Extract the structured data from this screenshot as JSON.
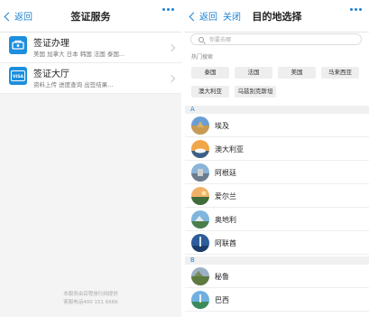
{
  "left": {
    "nav": {
      "back_label": "返回",
      "title": "签证服务"
    },
    "services": [
      {
        "title": "签证办理",
        "subtitle": "美国 加拿大 日本 韩国 法国 泰国..."
      },
      {
        "title": "签证大厅",
        "subtitle": "资料上传 进度查询 出签结果..."
      }
    ],
    "visa_badge": "VISA",
    "footer": {
      "line1": "本服务由百程旅行网提供",
      "line2": "客服电话400 151 6666"
    }
  },
  "right": {
    "nav": {
      "back_label": "返回",
      "close_label": "关闭",
      "title": "目的地选择"
    },
    "search_placeholder": "你要去哪",
    "hot_title": "热门搜索",
    "hot_items": [
      "泰国",
      "法国",
      "美国",
      "马来西亚",
      "澳大利亚",
      "乌兹别克斯坦"
    ],
    "sections": [
      {
        "letter": "A",
        "items": [
          "埃及",
          "澳大利亚",
          "阿根廷",
          "爱尔兰",
          "奥地利",
          "阿联酋"
        ]
      },
      {
        "letter": "B",
        "items": [
          "秘鲁",
          "巴西"
        ]
      }
    ]
  },
  "colors": {
    "accent": "#1e82d2",
    "icon_blue": "#1d8fde"
  }
}
